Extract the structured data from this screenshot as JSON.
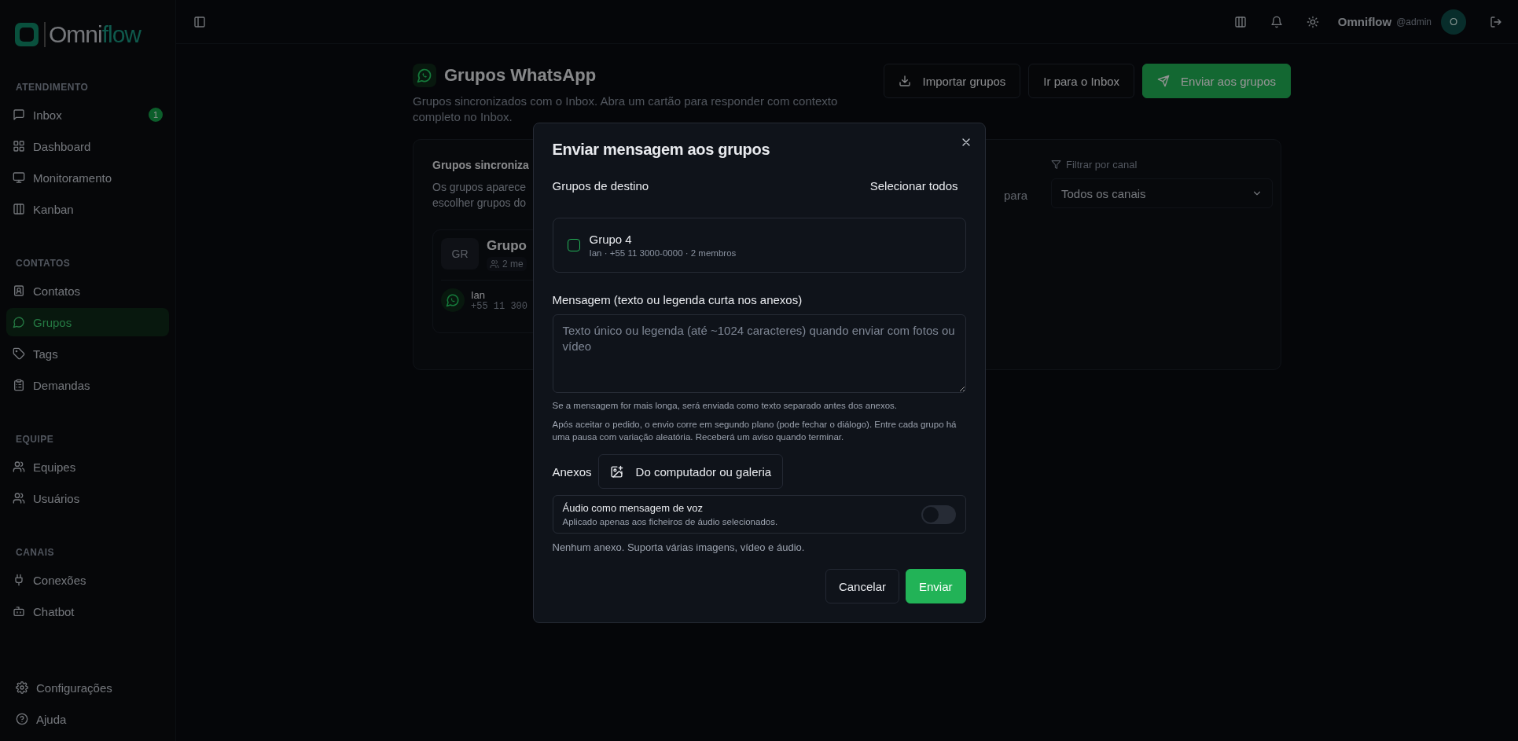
{
  "sidebar": {
    "logo": {
      "first": "Omni",
      "second": "flow"
    },
    "sections": [
      {
        "title": "ATENDIMENTO",
        "items": [
          {
            "label": "Inbox",
            "badge": "1",
            "selected": false
          },
          {
            "label": "Dashboard",
            "selected": false
          },
          {
            "label": "Monitoramento",
            "selected": false
          },
          {
            "label": "Kanban",
            "selected": false
          }
        ]
      },
      {
        "title": "CONTATOS",
        "items": [
          {
            "label": "Contatos",
            "selected": false
          },
          {
            "label": "Grupos",
            "selected": true
          },
          {
            "label": "Tags",
            "selected": false
          },
          {
            "label": "Demandas",
            "selected": false
          }
        ]
      },
      {
        "title": "EQUIPE",
        "items": [
          {
            "label": "Equipes",
            "selected": false
          },
          {
            "label": "Usuários",
            "selected": false
          }
        ]
      },
      {
        "title": "CANAIS",
        "items": [
          {
            "label": "Conexões",
            "selected": false
          },
          {
            "label": "Chatbot",
            "selected": false
          }
        ]
      }
    ],
    "footer": [
      {
        "label": "Configurações"
      },
      {
        "label": "Ajuda"
      }
    ]
  },
  "header": {
    "user_name": "Omniflow",
    "user_handle": "@admin",
    "avatar_initial": "O"
  },
  "page": {
    "title": "Grupos WhatsApp",
    "subtitle": "Grupos sincronizados com o Inbox. Abra um cartão para responder com contexto completo no Inbox.",
    "actions": [
      {
        "label": "Importar grupos",
        "kind": "outline"
      },
      {
        "label": "Ir para o Inbox",
        "kind": "outline"
      },
      {
        "label": "Enviar aos grupos",
        "kind": "primary"
      }
    ]
  },
  "card": {
    "title": "Grupos sincroniza",
    "description_lines": [
      "Os grupos aparece",
      "escolher grupos do"
    ],
    "description_tail": "para",
    "filter": {
      "label": "Filtrar por canal",
      "value": "Todos os canais"
    },
    "group": {
      "avatar": "GR",
      "name": "Grupo",
      "members": "2 me",
      "contact_name": "Ian",
      "contact_phone": "+55 11 300"
    }
  },
  "dialog": {
    "title": "Enviar mensagem aos grupos",
    "targets_label": "Grupos de destino",
    "select_all": "Selecionar todos",
    "groups": [
      {
        "name": "Grupo 4",
        "meta": "Ian · +55 11 3000-0000 · 2 membros",
        "checked": false
      }
    ],
    "message": {
      "label": "Mensagem (texto ou legenda curta nos anexos)",
      "placeholder": "Texto único ou legenda (até ~1024 caracteres) quando enviar com fotos ou vídeo"
    },
    "hints": [
      "Se a mensagem for mais longa, será enviada como texto separado antes dos anexos.",
      "Após aceitar o pedido, o envio corre em segundo plano (pode fechar o diálogo). Entre cada grupo há uma pausa com variação aleatória. Receberá um aviso quando terminar."
    ],
    "attachments_label": "Anexos",
    "attach_button": "Do computador ou galeria",
    "voice_option": {
      "title": "Áudio como mensagem de voz",
      "description": "Aplicado apenas aos ficheiros de áudio selecionados.",
      "on": false
    },
    "attachments_status": "Nenhum anexo. Suporta várias imagens, vídeo e áudio.",
    "buttons": [
      {
        "label": "Cancelar",
        "kind": "secondary"
      },
      {
        "label": "Enviar",
        "kind": "primary"
      }
    ]
  }
}
